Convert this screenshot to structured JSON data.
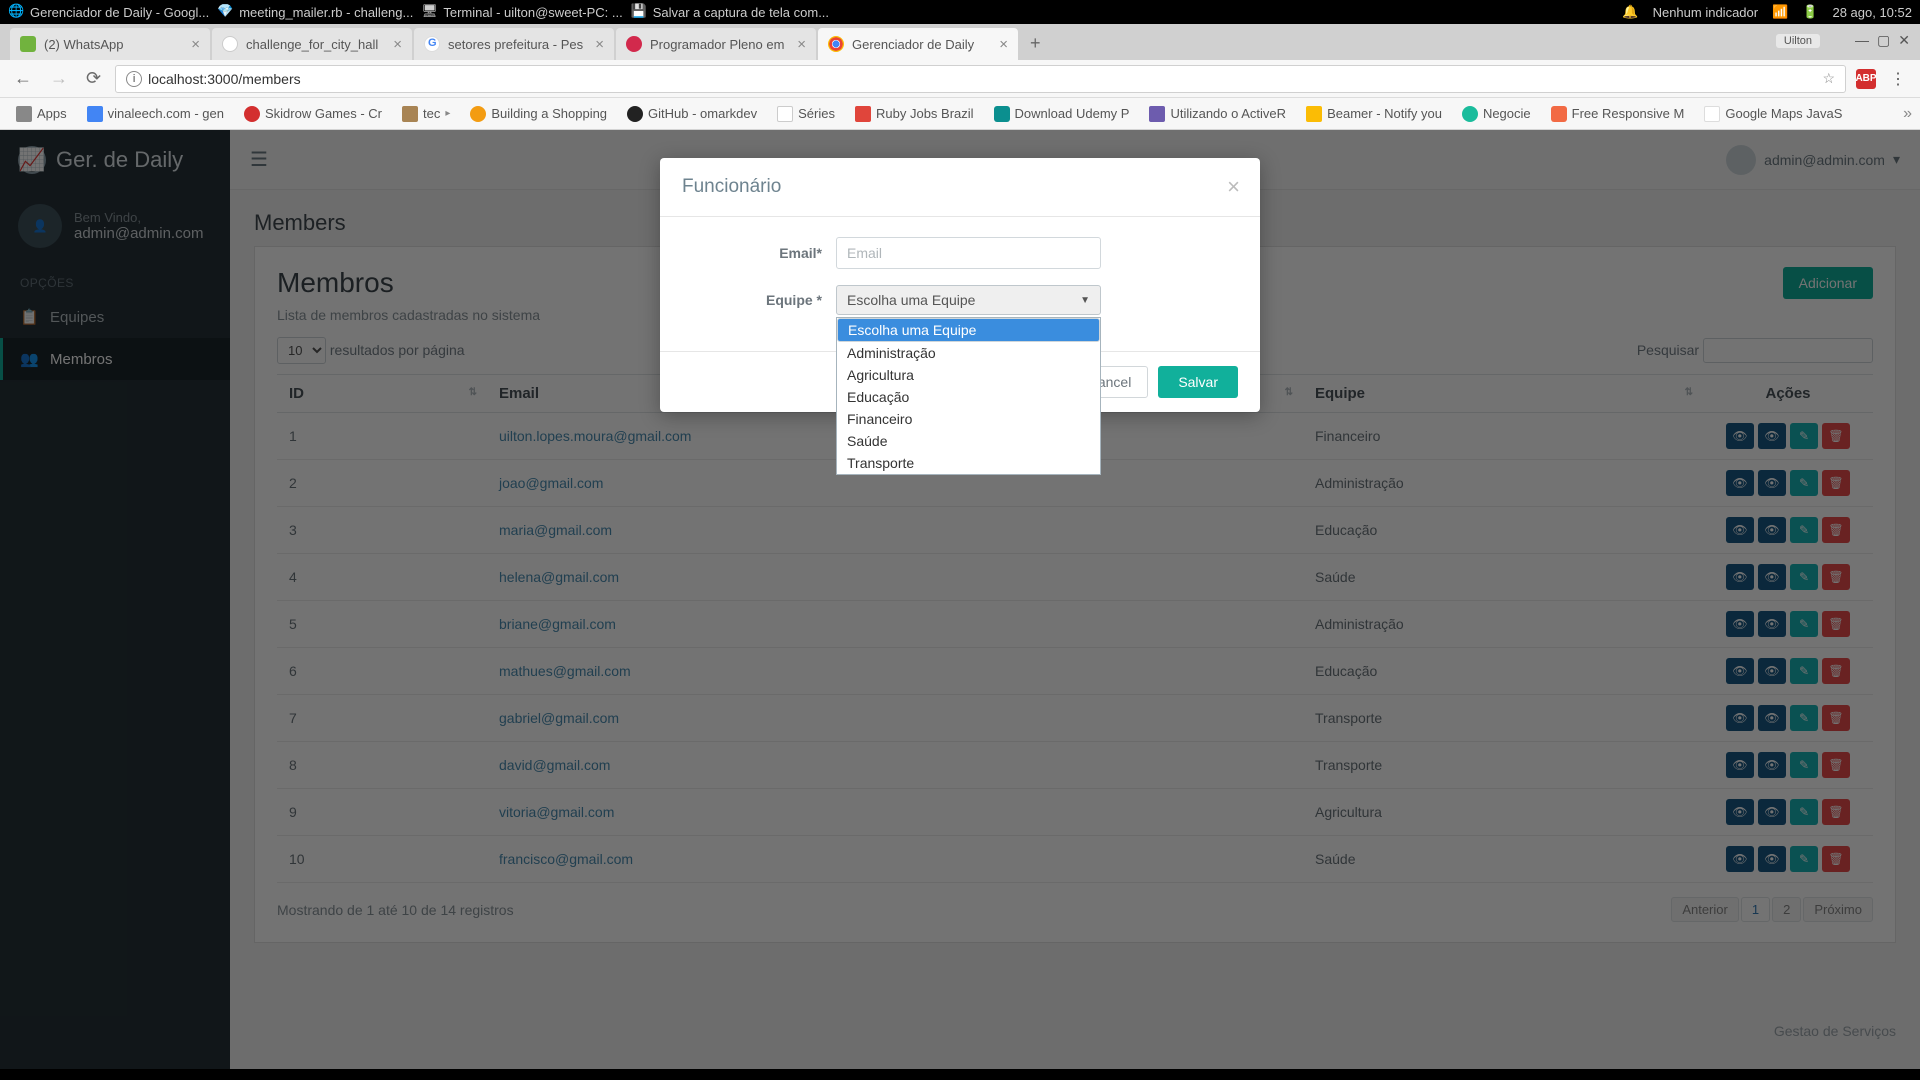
{
  "os": {
    "tasks": [
      {
        "icon": "chrome",
        "label": "Gerenciador de Daily - Googl..."
      },
      {
        "icon": "ruby",
        "label": "meeting_mailer.rb - challeng..."
      },
      {
        "icon": "term",
        "label": "Terminal - uilton@sweet-PC: ..."
      },
      {
        "icon": "save",
        "label": "Salvar a captura de tela com..."
      }
    ],
    "indicator": "Nenhum indicador",
    "date": "28 ago, 10:52"
  },
  "browser": {
    "tabs": [
      {
        "fav": "green",
        "title": "(2) WhatsApp",
        "active": false
      },
      {
        "fav": "github",
        "title": "challenge_for_city_hall",
        "active": false
      },
      {
        "fav": "google",
        "title": "setores prefeitura - Pes",
        "active": false
      },
      {
        "fav": "inf",
        "title": "Programador Pleno em",
        "active": false
      },
      {
        "fav": "chrome-o",
        "title": "Gerenciador de Daily",
        "active": true
      }
    ],
    "user_chip": "Uilton",
    "address": "localhost:3000/members",
    "bookmarks": [
      {
        "ico": "apps",
        "label": "Apps"
      },
      {
        "ico": "blue",
        "label": "vinaleech.com - gen"
      },
      {
        "ico": "red",
        "label": "Skidrow Games - Cr"
      },
      {
        "ico": "folder",
        "label": "tec",
        "chev": true
      },
      {
        "ico": "orange",
        "label": "Building a Shopping"
      },
      {
        "ico": "dark",
        "label": "GitHub - omarkdev"
      },
      {
        "ico": "wiki",
        "label": "Séries"
      },
      {
        "ico": "redr",
        "label": "Ruby Jobs Brazil"
      },
      {
        "ico": "teal",
        "label": "Download Udemy P"
      },
      {
        "ico": "pur",
        "label": "Utilizando o ActiveR"
      },
      {
        "ico": "yb",
        "label": "Beamer - Notify you"
      },
      {
        "ico": "helix",
        "label": "Negocie"
      },
      {
        "ico": "org2",
        "label": "Free Responsive M"
      },
      {
        "ico": "ggl",
        "label": "Google Maps JavaS"
      }
    ]
  },
  "sidebar": {
    "brand": "Ger. de Daily",
    "welcome": "Bem Vindo,",
    "user": "admin@admin.com",
    "section": "OPÇÕES",
    "items": [
      {
        "icon": "📋",
        "label": "Equipes"
      },
      {
        "icon": "👥",
        "label": "Membros"
      }
    ]
  },
  "header": {
    "user": "admin@admin.com"
  },
  "page": {
    "title": "Members",
    "card_title": "Membros",
    "add": "Adicionar",
    "subtitle": "Lista de membros cadastradas no sistema",
    "per_page_value": "10",
    "per_page_label": "resultados por página",
    "search_label": "Pesquisar",
    "columns": {
      "id": "ID",
      "email": "Email",
      "equipe": "Equipe",
      "acoes": "Ações"
    },
    "rows": [
      {
        "id": "1",
        "email": "uilton.lopes.moura@gmail.com",
        "equipe": "Financeiro"
      },
      {
        "id": "2",
        "email": "joao@gmail.com",
        "equipe": "Administração"
      },
      {
        "id": "3",
        "email": "maria@gmail.com",
        "equipe": "Educação"
      },
      {
        "id": "4",
        "email": "helena@gmail.com",
        "equipe": "Saúde"
      },
      {
        "id": "5",
        "email": "briane@gmail.com",
        "equipe": "Administração"
      },
      {
        "id": "6",
        "email": "mathues@gmail.com",
        "equipe": "Educação"
      },
      {
        "id": "7",
        "email": "gabriel@gmail.com",
        "equipe": "Transporte"
      },
      {
        "id": "8",
        "email": "david@gmail.com",
        "equipe": "Transporte"
      },
      {
        "id": "9",
        "email": "vitoria@gmail.com",
        "equipe": "Agricultura"
      },
      {
        "id": "10",
        "email": "francisco@gmail.com",
        "equipe": "Saúde"
      }
    ],
    "showing": "Mostrando de 1 até 10 de 14 registros",
    "pager": {
      "prev": "Anterior",
      "pages": [
        "1",
        "2"
      ],
      "next": "Próximo"
    },
    "footer": "Gestao de Serviços"
  },
  "modal": {
    "title": "Funcionário",
    "email_label": "Email*",
    "email_placeholder": "Email",
    "equipe_label": "Equipe *",
    "equipe_selected": "Escolha uma Equipe",
    "options": [
      "Escolha uma Equipe",
      "Administração",
      "Agricultura",
      "Educação",
      "Financeiro",
      "Saúde",
      "Transporte"
    ],
    "cancel": "Cancel",
    "save": "Salvar"
  }
}
